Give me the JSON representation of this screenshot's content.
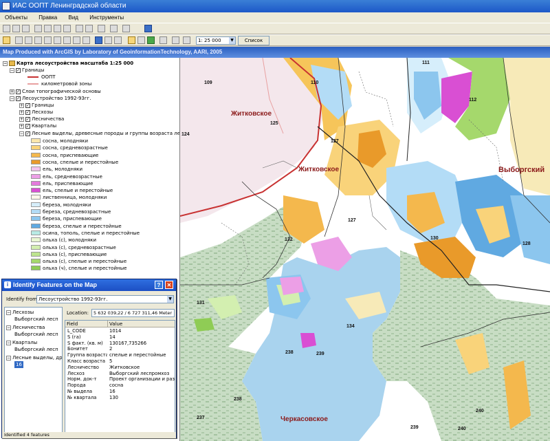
{
  "window": {
    "title": "ИАС ООПТ Ленинградской области"
  },
  "menu": [
    "Объекты",
    "Правка",
    "Вид",
    "Инструменты"
  ],
  "toolbar": {
    "scale": "1: 25 000",
    "map_list_label": "Список карт"
  },
  "banner": "Map Produced with ArcGIS by Laboratory of GeoinformationTechnology, AARI, 2005",
  "toc": {
    "title": "Карта лесоустройства масштаба 1:25 000",
    "boundaries": "Границы",
    "oopt": "ООПТ",
    "km_zone": "километровой зоны",
    "topo_layer": "Слои топографической основы",
    "forestry": "Лесоустройство 1992-93гг.",
    "sublayers": [
      "Границы",
      "Лесхозы",
      "Лесничества",
      "Кварталы"
    ],
    "stands_layer": "Лесные выделы, древесные породы и группы возраста леса",
    "legend": [
      {
        "label": "сосна, молодняки",
        "color": "#fbe7ad"
      },
      {
        "label": "сосна, средневозрастные",
        "color": "#f9d37a"
      },
      {
        "label": "сосна, приспевающие",
        "color": "#f4b84d"
      },
      {
        "label": "сосна, спелые и перестойные",
        "color": "#e99a2a"
      },
      {
        "label": "ель, молодняки",
        "color": "#f3c3ee"
      },
      {
        "label": "ель, средневозрастные",
        "color": "#ec9fe6"
      },
      {
        "label": "ель, приспевающие",
        "color": "#e47add"
      },
      {
        "label": "ель, спелые и перестойные",
        "color": "#d94fd3"
      },
      {
        "label": "лиственница, молодняки",
        "color": "#fff7ea"
      },
      {
        "label": "береза, молодняки",
        "color": "#d6eefb"
      },
      {
        "label": "береза, средневозрастные",
        "color": "#b3dcf6"
      },
      {
        "label": "береза, приспевающие",
        "color": "#8cc6ee"
      },
      {
        "label": "береза, спелые и перестойные",
        "color": "#60a9e1"
      },
      {
        "label": "осина, тополь, спелые и перестойные",
        "color": "#b8eae4"
      },
      {
        "label": "ольха (с), молодняки",
        "color": "#e9f7d2"
      },
      {
        "label": "ольха (с), средневозрастные",
        "color": "#d3efb0"
      },
      {
        "label": "ольха (с), приспевающие",
        "color": "#bde48e"
      },
      {
        "label": "ольха (с), спелые и перестойные",
        "color": "#a5d86c"
      },
      {
        "label": "ольха (ч), спелые и перестойные",
        "color": "#8fcc55"
      }
    ]
  },
  "identify": {
    "title": "Identify Features on the Map",
    "help": "?",
    "close": "✕",
    "from_label": "Identify from:",
    "from_value": "Лесоустройство 1992-93гг.",
    "tree": [
      {
        "label": "Лесхозы",
        "child": "Выборгский лесп"
      },
      {
        "label": "Лесничества",
        "child": "Выборгский лесп"
      },
      {
        "label": "Кварталы",
        "child": "Выборгский лесп"
      },
      {
        "label": "Лесные выделы, дре",
        "child": "16"
      }
    ],
    "location_label": "Location:",
    "location_value": "5 632 039,22 / 6 727 311,46 Meter",
    "field_header": "Field",
    "value_header": "Value",
    "rows": [
      {
        "field": "L_CODE",
        "value": "1014"
      },
      {
        "field": "S (га)",
        "value": "14"
      },
      {
        "field": "S факт. (кв. м)",
        "value": "130167,735266"
      },
      {
        "field": "Бонитет",
        "value": "2"
      },
      {
        "field": "Группа возраста",
        "value": "спелые и перестойные"
      },
      {
        "field": "Класс возраста",
        "value": "5"
      },
      {
        "field": "Лесничество",
        "value": "Житковское"
      },
      {
        "field": "Лесхоз",
        "value": "Выборгский леспромхоз"
      },
      {
        "field": "Норм. док-т",
        "value": "Проект организации и развит"
      },
      {
        "field": "Порода",
        "value": "сосна"
      },
      {
        "field": "№ выдела",
        "value": "16"
      },
      {
        "field": "№ квартала",
        "value": "130"
      }
    ],
    "status": "Identified 4 features"
  },
  "map": {
    "places": [
      "Житковское",
      "Житковское",
      "Выборгский",
      "Черкасовское"
    ],
    "quarters": [
      "109",
      "110",
      "111",
      "112",
      "125",
      "124",
      "127",
      "127",
      "132",
      "130",
      "128",
      "131",
      "134",
      "238",
      "239",
      "238",
      "237",
      "239",
      "240",
      "240"
    ],
    "colors": {
      "water": "#a9d3ee",
      "wetland": "#c8ddc4",
      "oopt_boundary": "#c83232"
    }
  }
}
